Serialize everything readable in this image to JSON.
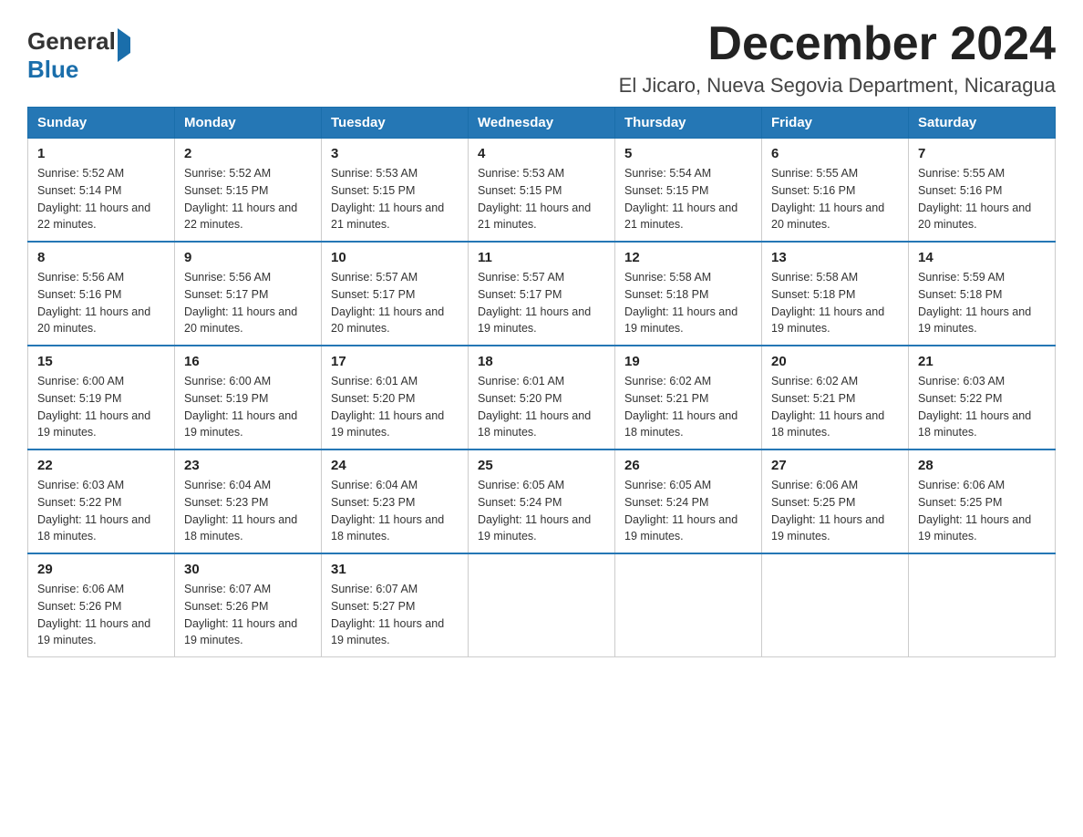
{
  "header": {
    "logo_general": "General",
    "logo_blue": "Blue",
    "month_title": "December 2024",
    "location": "El Jicaro, Nueva Segovia Department, Nicaragua"
  },
  "days_of_week": [
    "Sunday",
    "Monday",
    "Tuesday",
    "Wednesday",
    "Thursday",
    "Friday",
    "Saturday"
  ],
  "weeks": [
    [
      {
        "day": "1",
        "sunrise": "5:52 AM",
        "sunset": "5:14 PM",
        "daylight": "11 hours and 22 minutes."
      },
      {
        "day": "2",
        "sunrise": "5:52 AM",
        "sunset": "5:15 PM",
        "daylight": "11 hours and 22 minutes."
      },
      {
        "day": "3",
        "sunrise": "5:53 AM",
        "sunset": "5:15 PM",
        "daylight": "11 hours and 21 minutes."
      },
      {
        "day": "4",
        "sunrise": "5:53 AM",
        "sunset": "5:15 PM",
        "daylight": "11 hours and 21 minutes."
      },
      {
        "day": "5",
        "sunrise": "5:54 AM",
        "sunset": "5:15 PM",
        "daylight": "11 hours and 21 minutes."
      },
      {
        "day": "6",
        "sunrise": "5:55 AM",
        "sunset": "5:16 PM",
        "daylight": "11 hours and 20 minutes."
      },
      {
        "day": "7",
        "sunrise": "5:55 AM",
        "sunset": "5:16 PM",
        "daylight": "11 hours and 20 minutes."
      }
    ],
    [
      {
        "day": "8",
        "sunrise": "5:56 AM",
        "sunset": "5:16 PM",
        "daylight": "11 hours and 20 minutes."
      },
      {
        "day": "9",
        "sunrise": "5:56 AM",
        "sunset": "5:17 PM",
        "daylight": "11 hours and 20 minutes."
      },
      {
        "day": "10",
        "sunrise": "5:57 AM",
        "sunset": "5:17 PM",
        "daylight": "11 hours and 20 minutes."
      },
      {
        "day": "11",
        "sunrise": "5:57 AM",
        "sunset": "5:17 PM",
        "daylight": "11 hours and 19 minutes."
      },
      {
        "day": "12",
        "sunrise": "5:58 AM",
        "sunset": "5:18 PM",
        "daylight": "11 hours and 19 minutes."
      },
      {
        "day": "13",
        "sunrise": "5:58 AM",
        "sunset": "5:18 PM",
        "daylight": "11 hours and 19 minutes."
      },
      {
        "day": "14",
        "sunrise": "5:59 AM",
        "sunset": "5:18 PM",
        "daylight": "11 hours and 19 minutes."
      }
    ],
    [
      {
        "day": "15",
        "sunrise": "6:00 AM",
        "sunset": "5:19 PM",
        "daylight": "11 hours and 19 minutes."
      },
      {
        "day": "16",
        "sunrise": "6:00 AM",
        "sunset": "5:19 PM",
        "daylight": "11 hours and 19 minutes."
      },
      {
        "day": "17",
        "sunrise": "6:01 AM",
        "sunset": "5:20 PM",
        "daylight": "11 hours and 19 minutes."
      },
      {
        "day": "18",
        "sunrise": "6:01 AM",
        "sunset": "5:20 PM",
        "daylight": "11 hours and 18 minutes."
      },
      {
        "day": "19",
        "sunrise": "6:02 AM",
        "sunset": "5:21 PM",
        "daylight": "11 hours and 18 minutes."
      },
      {
        "day": "20",
        "sunrise": "6:02 AM",
        "sunset": "5:21 PM",
        "daylight": "11 hours and 18 minutes."
      },
      {
        "day": "21",
        "sunrise": "6:03 AM",
        "sunset": "5:22 PM",
        "daylight": "11 hours and 18 minutes."
      }
    ],
    [
      {
        "day": "22",
        "sunrise": "6:03 AM",
        "sunset": "5:22 PM",
        "daylight": "11 hours and 18 minutes."
      },
      {
        "day": "23",
        "sunrise": "6:04 AM",
        "sunset": "5:23 PM",
        "daylight": "11 hours and 18 minutes."
      },
      {
        "day": "24",
        "sunrise": "6:04 AM",
        "sunset": "5:23 PM",
        "daylight": "11 hours and 18 minutes."
      },
      {
        "day": "25",
        "sunrise": "6:05 AM",
        "sunset": "5:24 PM",
        "daylight": "11 hours and 19 minutes."
      },
      {
        "day": "26",
        "sunrise": "6:05 AM",
        "sunset": "5:24 PM",
        "daylight": "11 hours and 19 minutes."
      },
      {
        "day": "27",
        "sunrise": "6:06 AM",
        "sunset": "5:25 PM",
        "daylight": "11 hours and 19 minutes."
      },
      {
        "day": "28",
        "sunrise": "6:06 AM",
        "sunset": "5:25 PM",
        "daylight": "11 hours and 19 minutes."
      }
    ],
    [
      {
        "day": "29",
        "sunrise": "6:06 AM",
        "sunset": "5:26 PM",
        "daylight": "11 hours and 19 minutes."
      },
      {
        "day": "30",
        "sunrise": "6:07 AM",
        "sunset": "5:26 PM",
        "daylight": "11 hours and 19 minutes."
      },
      {
        "day": "31",
        "sunrise": "6:07 AM",
        "sunset": "5:27 PM",
        "daylight": "11 hours and 19 minutes."
      },
      null,
      null,
      null,
      null
    ]
  ],
  "labels": {
    "sunrise": "Sunrise:",
    "sunset": "Sunset:",
    "daylight": "Daylight:"
  }
}
